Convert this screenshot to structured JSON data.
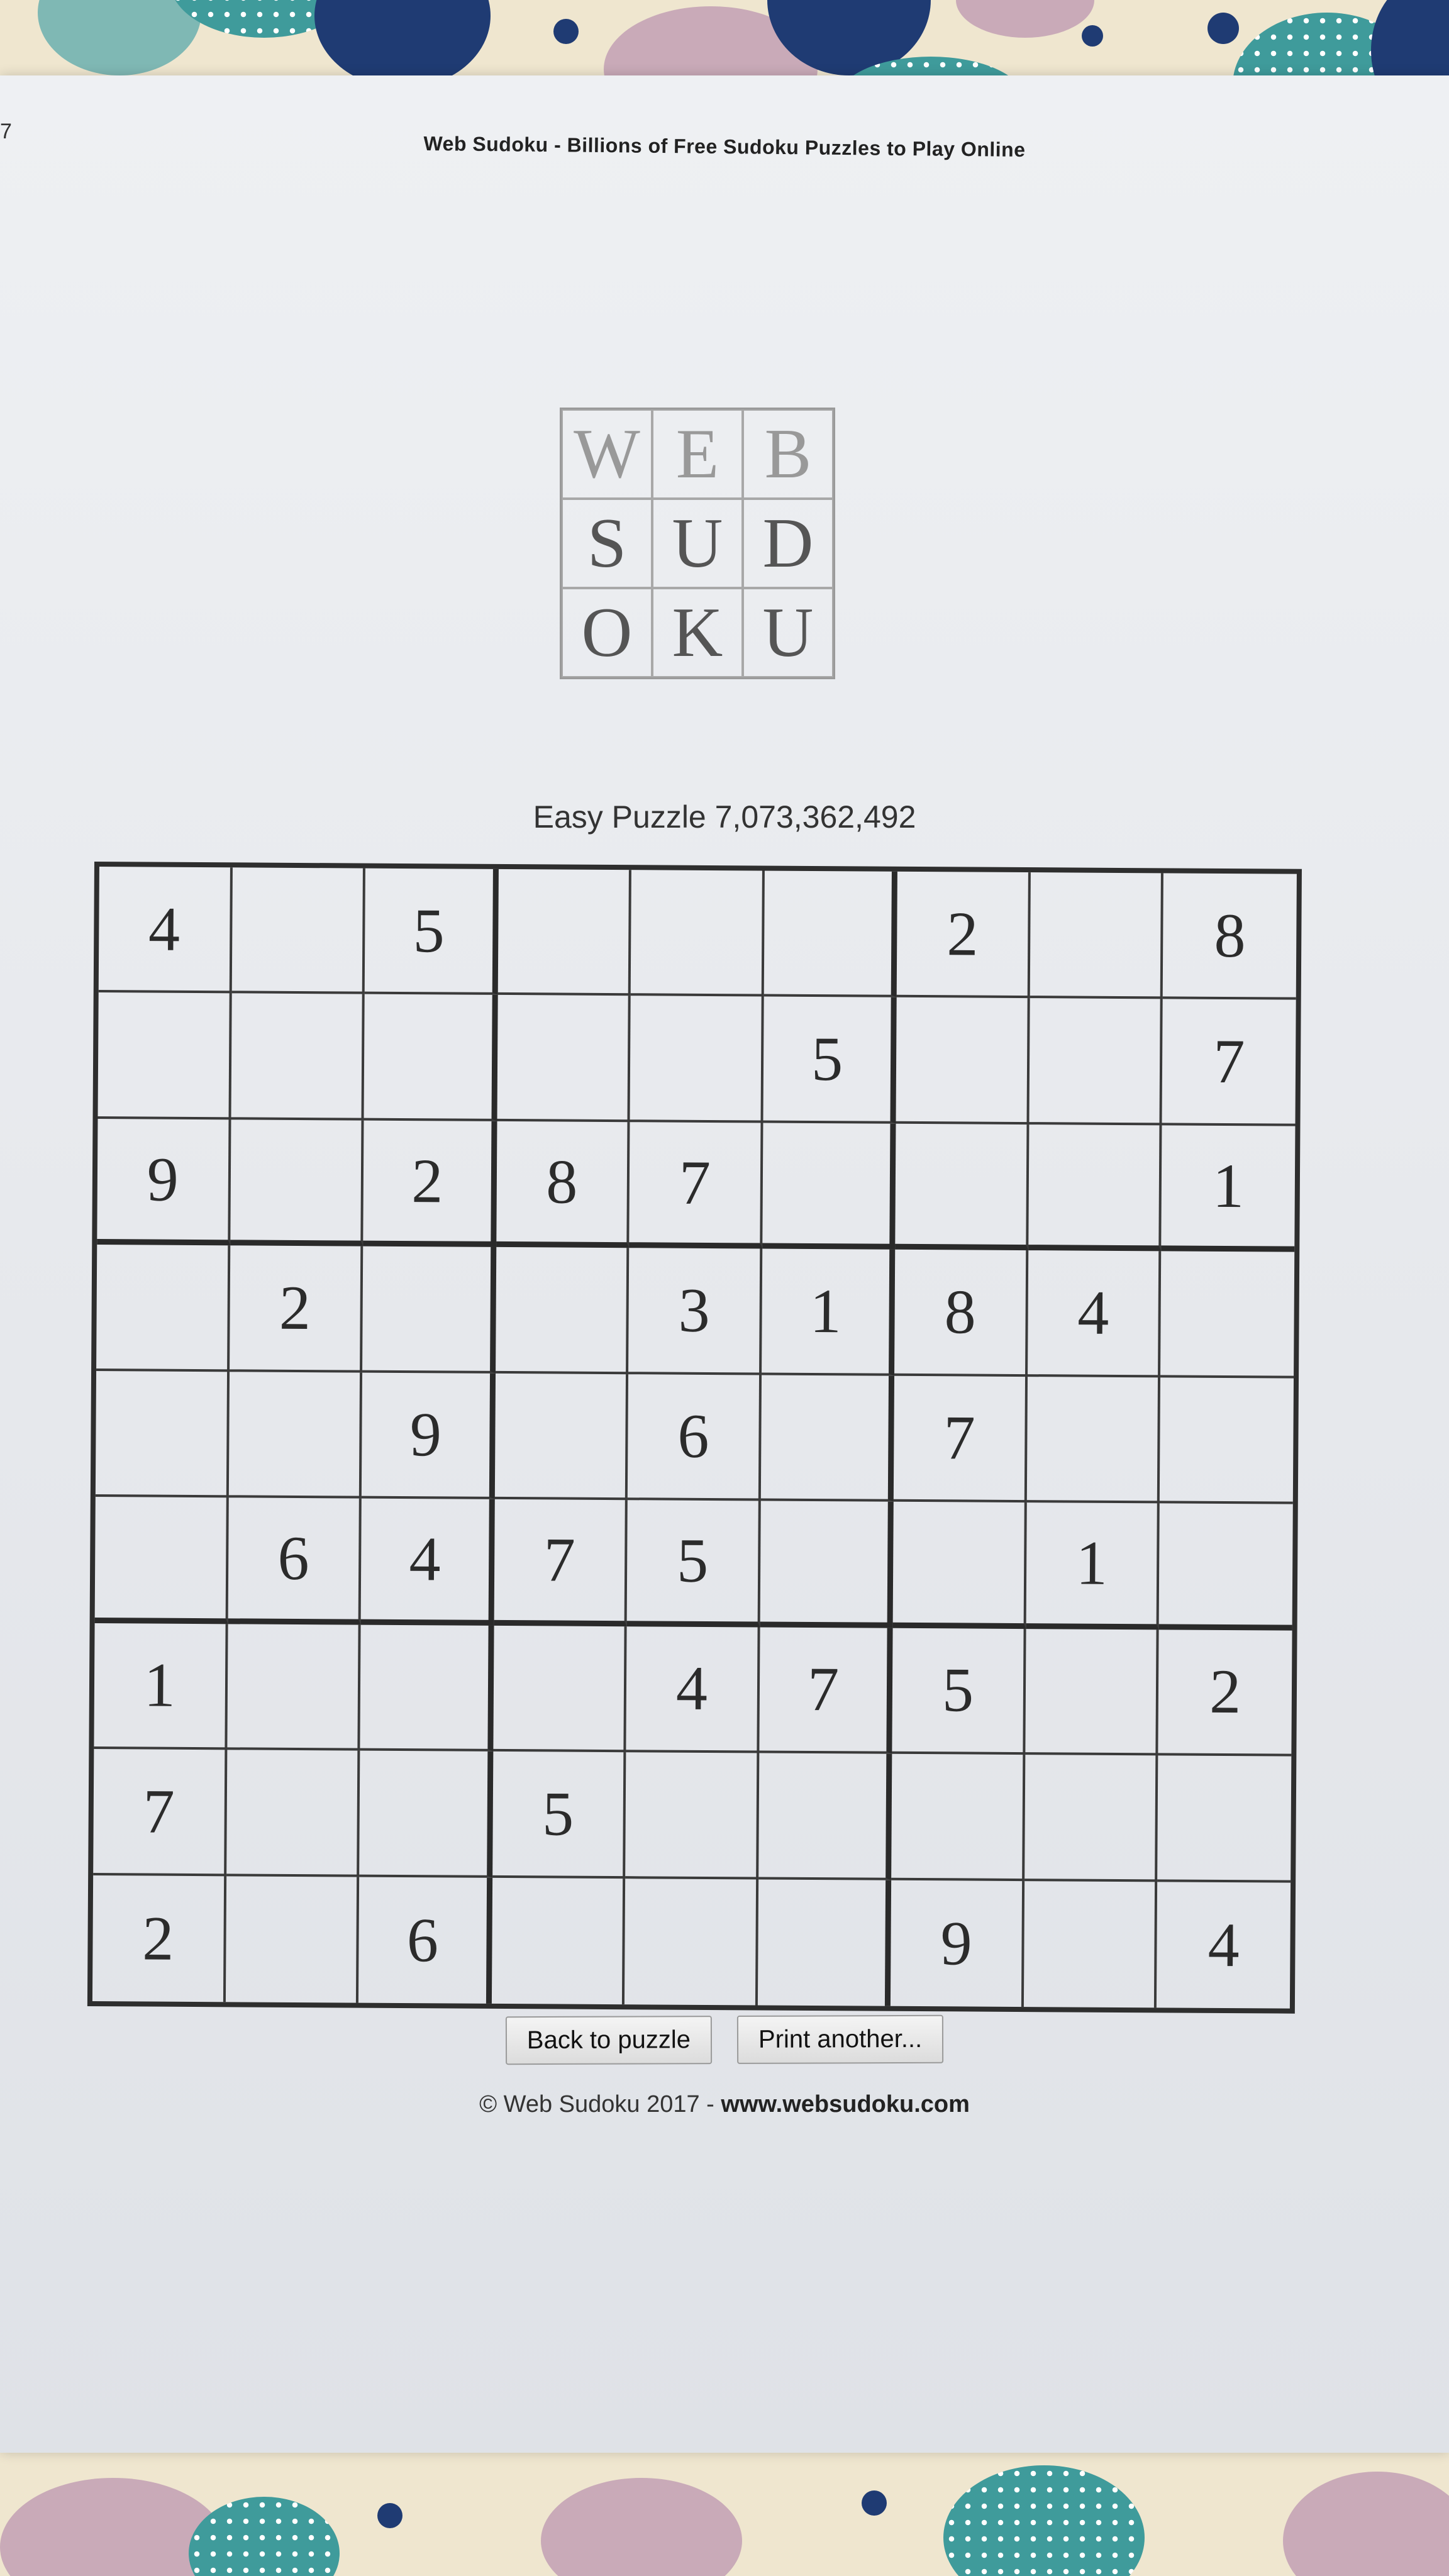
{
  "page": {
    "page_number": "7",
    "header_title": "Web Sudoku - Billions of Free Sudoku Puzzles to Play Online"
  },
  "logo": {
    "letters": [
      "W",
      "E",
      "B",
      "S",
      "U",
      "D",
      "O",
      "K",
      "U"
    ]
  },
  "puzzle": {
    "title": "Easy Puzzle 7,073,362,492",
    "grid": [
      [
        "4",
        "",
        "5",
        "",
        "",
        "",
        "2",
        "",
        "8"
      ],
      [
        "",
        "",
        "",
        "",
        "",
        "5",
        "",
        "",
        "7"
      ],
      [
        "9",
        "",
        "2",
        "8",
        "7",
        "",
        "",
        "",
        "1"
      ],
      [
        "",
        "2",
        "",
        "",
        "3",
        "1",
        "8",
        "4",
        ""
      ],
      [
        "",
        "",
        "9",
        "",
        "6",
        "",
        "7",
        "",
        ""
      ],
      [
        "",
        "6",
        "4",
        "7",
        "5",
        "",
        "",
        "1",
        ""
      ],
      [
        "1",
        "",
        "",
        "",
        "4",
        "7",
        "5",
        "",
        "2"
      ],
      [
        "7",
        "",
        "",
        "5",
        "",
        "",
        "",
        "",
        ""
      ],
      [
        "2",
        "",
        "6",
        "",
        "",
        "",
        "9",
        "",
        "4"
      ]
    ]
  },
  "buttons": {
    "back_label": "Back to puzzle",
    "print_label": "Print another..."
  },
  "footer": {
    "copyright": "© Web Sudoku 2017 - ",
    "site": "www.websudoku.com"
  }
}
